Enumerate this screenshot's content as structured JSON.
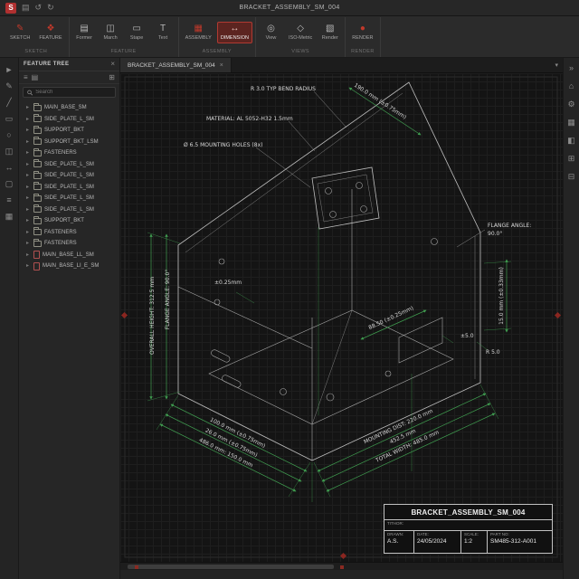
{
  "colors": {
    "accent": "#c0392b",
    "dimension_green": "#3f9b4f",
    "line_gray": "#bfbfbf"
  },
  "titlebar": {
    "title": "BRACKET_ASSEMBLY_SM_004",
    "logo_text": "S",
    "icons": {
      "menu": "▤",
      "undo": "↺",
      "redo": "↻"
    }
  },
  "ribbon": {
    "buttons": [
      {
        "label": "SKETCH",
        "glyph": "✎"
      },
      {
        "label": "FEATURE",
        "glyph": "❖"
      },
      {
        "label": "Former",
        "glyph": "▤"
      },
      {
        "label": "March",
        "glyph": "◫"
      },
      {
        "label": "Stape",
        "glyph": "▭"
      },
      {
        "label": "Text",
        "glyph": "T"
      },
      {
        "label": "ASSEMBLY",
        "glyph": "▦"
      },
      {
        "label": "DIMENSION",
        "glyph": "↔"
      },
      {
        "label": "View",
        "glyph": "◎"
      },
      {
        "label": "ISO-Metric",
        "glyph": "◇"
      },
      {
        "label": "Render",
        "glyph": "▧"
      },
      {
        "label": "RENDER",
        "glyph": "●"
      }
    ],
    "groups": [
      "SKETCH",
      "FEATURE",
      "ASSEMBLY",
      "VIEWS",
      "RENDER"
    ]
  },
  "left_toolbar": {
    "glyphs": [
      "►",
      "✎",
      "╱",
      "▭",
      "○",
      "◫",
      "↔",
      "▢",
      "≡",
      "▦"
    ]
  },
  "right_toolbar": {
    "glyphs": [
      "»",
      "⌂",
      "⚙",
      "▦",
      "◧",
      "⊞",
      "⊟"
    ]
  },
  "feature_tree": {
    "title": "FEATURE TREE",
    "close": "×",
    "chevron": "▸",
    "toolbar_glyphs": [
      "≡",
      "▤",
      "⊞"
    ],
    "search_placeholder": "Search",
    "items": [
      "MAIN_BASE_SM",
      "SIDE_PLATE_L_SM",
      "SUPPORT_BKT",
      "SUPPORT_BKT_LSM",
      "FASTENERS",
      "SIDE_PLATE_L_SM",
      "SIDE_PLATE_L_SM",
      "SIDE_PLATE_L_SM",
      "SIDE_PLATE_L_SM",
      "SIDE_PLATE_L_SM",
      "SUPPORT_BKT",
      "FASTENERS",
      "FASTENERS",
      "MAIN_BASE_LL_SM",
      "MAIN_BASE_LI_E_SM"
    ]
  },
  "tabs": {
    "active": "BRACKET_ASSEMBLY_SM_004",
    "close": "×",
    "chevron": "▾"
  },
  "drawing": {
    "callouts": {
      "bend_radius": "R 3.0 TYP BEND RADIUS",
      "material": "MATERIAL: AL 5052-H32 1.5mm",
      "mounting_holes": "Ø 6.5 MOUNTING HOLES (8x)",
      "flange_angle_right_1": "FLANGE ANGLE:",
      "flange_angle_right_2": "90.0°"
    },
    "dimensions": {
      "top_edge": "190.0 mm (±0.75mm)",
      "overall_height": "OVERALL HEIGHT: 312.5 mm",
      "flange_angle_left": "FLANGE ANGLE: 90.0°",
      "tol_center": "±0.25mm",
      "dim_8850": "88.50 (±0.25mm)",
      "dim_150": "15.0 mm (±0.33mm)",
      "r50": "R 5.0",
      "tol_50": "±5.0",
      "dim_1000": "100.0 mm (±0.75mm)",
      "dim_260": "26.0 mm (±0.75mm)",
      "dim_4860": "486.0 mm: 150.0 mm",
      "mounting_dist": "MOUNTING DIST: 220.0 mm",
      "dim_4525": "452.5 mm",
      "total_width": "TOTAL WIDTH: 485.0 mm"
    },
    "title_block": {
      "title": "BRACKET_ASSEMBLY_SM_004",
      "author_label": "TITHOR:",
      "drawn_label": "DRAWN:",
      "drawn_value": "A.S.",
      "date_label": "DATE:",
      "date_value": "24/05/2024",
      "scale_label": "SCALE:",
      "scale_value": "1:2",
      "part_no_label": "PART NO:",
      "part_no_value": "SM485-312-A001"
    }
  }
}
